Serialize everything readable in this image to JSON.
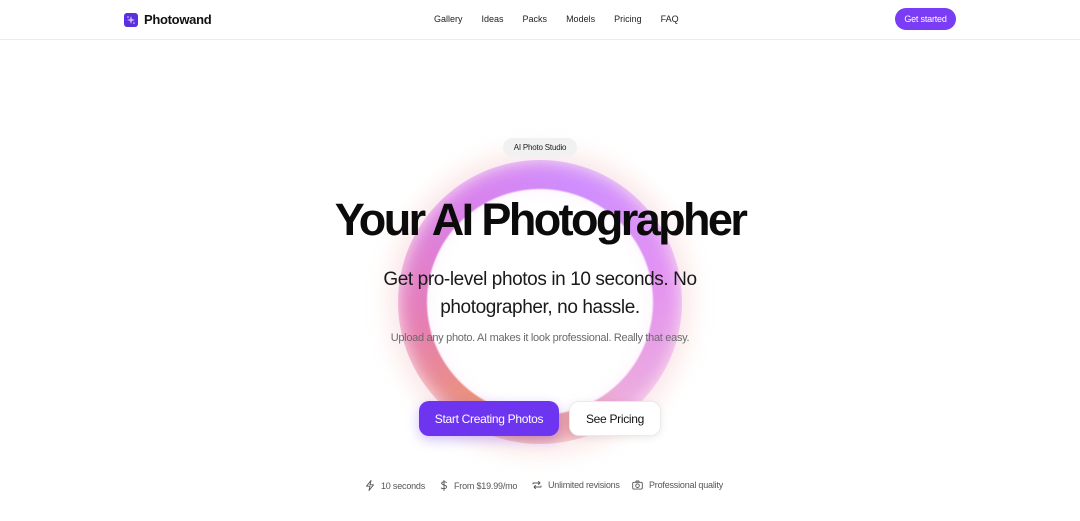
{
  "brand": {
    "name": "Photowand",
    "logo_icon": "sparkle-grid-icon",
    "accent": "#6d35f0"
  },
  "nav": {
    "items": [
      {
        "label": "Gallery"
      },
      {
        "label": "Ideas"
      },
      {
        "label": "Packs"
      },
      {
        "label": "Models"
      },
      {
        "label": "Pricing"
      },
      {
        "label": "FAQ"
      }
    ],
    "cta_label": "Get started"
  },
  "hero": {
    "badge": "AI Photo Studio",
    "title": "Your AI Photographer",
    "subtitle": "Get pro-level photos in 10 seconds. No photographer, no hassle.",
    "description": "Upload any photo. AI makes it look professional. Really that easy.",
    "primary_button": "Start Creating Photos",
    "secondary_button": "See Pricing"
  },
  "features": [
    {
      "icon": "lightning-icon",
      "label": "10 seconds"
    },
    {
      "icon": "dollar-icon",
      "label": "From $19.99/mo"
    },
    {
      "icon": "repeat-icon",
      "label": "Unlimited revisions"
    },
    {
      "icon": "camera-icon",
      "label": "Professional quality"
    }
  ]
}
